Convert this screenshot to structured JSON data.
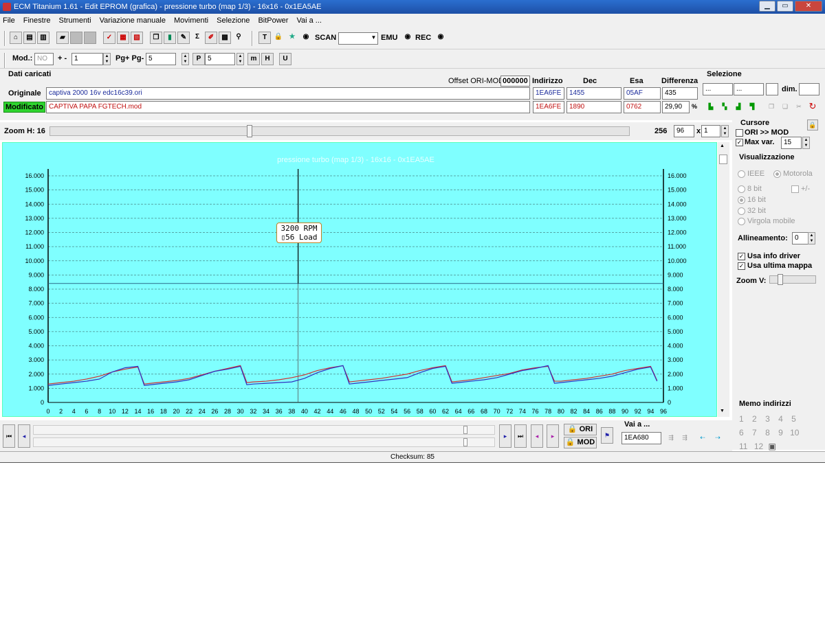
{
  "window": {
    "title": "ECM Titanium 1.61 - Edit EPROM (grafica) - pressione turbo (map 1/3) - 16x16 - 0x1EA5AE"
  },
  "menu": [
    "File",
    "Finestre",
    "Strumenti",
    "Variazione manuale",
    "Movimenti",
    "Selezione",
    "BitPower",
    "Vai a ..."
  ],
  "toolbar": {
    "scan": "SCAN",
    "emu": "EMU",
    "rec": "REC",
    "mod_label": "Mod.:",
    "mod_value": "NO",
    "plusminus": "+ -",
    "step_value": "1",
    "pg_label": "Pg+ Pg-",
    "pg_value": "5",
    "p_value": "5"
  },
  "loaded": {
    "section": "Dati caricati",
    "offset_label": "Offset ORI-MOD",
    "offset_value": "000000",
    "col_indirizzo": "Indirizzo",
    "col_dec": "Dec",
    "col_esa": "Esa",
    "col_diff": "Differenza",
    "orig_label": "Originale",
    "orig_file": "captiva 2000 16v edc16c39.ori",
    "orig_addr": "1EA6FE",
    "orig_dec": "1455",
    "orig_esa": "05AF",
    "orig_diff": "435",
    "mod_label": "Modificato",
    "mod_file": "CAPTIVA PAPA FGTECH.mod",
    "mod_addr": "1EA6FE",
    "mod_dec": "1890",
    "mod_esa": "0762",
    "mod_diff_pct": "29,90",
    "pct": "%"
  },
  "selezione": {
    "title": "Selezione",
    "a": "...",
    "b": "...",
    "dim": "dim."
  },
  "zoom": {
    "label": "Zoom H: 16",
    "value1": "256",
    "value2": "96",
    "times": "x",
    "value3": "1"
  },
  "cursore": {
    "title": "Cursore",
    "ori_mod": "ORI >> MOD",
    "maxvar": "Max var.",
    "maxvar_value": "15"
  },
  "vis": {
    "title": "Visualizzazione",
    "ieee": "IEEE",
    "motorola": "Motorola",
    "b8": "8 bit",
    "pm": "+/-",
    "b16": "16 bit",
    "b32": "32 bit",
    "virgola": "Virgola mobile",
    "allineamento": "Allineamento:",
    "allin_value": "0",
    "usa_info": "Usa info driver",
    "usa_ultima": "Usa ultima mappa",
    "zoomv": "Zoom V:"
  },
  "memo": {
    "title": "Memo indirizzi",
    "nums": [
      "1",
      "2",
      "3",
      "4",
      "5",
      "6",
      "7",
      "8",
      "9",
      "10",
      "11",
      "12"
    ]
  },
  "bottom": {
    "ori": "ORI",
    "mod": "MOD",
    "vai": "Vai a ...",
    "vai_value": "1EA680"
  },
  "status": {
    "checksum": "Checksum: 85"
  },
  "tooltip": {
    "line1": "3200 RPM",
    "line2": "▯56 Load"
  },
  "chart_data": {
    "type": "line",
    "title": "pressione turbo (map 1/3) - 16x16 - 0x1EA5AE",
    "xlim": [
      0,
      96
    ],
    "ylim": [
      0,
      16000
    ],
    "xticks": [
      "0",
      "2",
      "4",
      "6",
      "8",
      "10",
      "12",
      "14",
      "16",
      "18",
      "20",
      "22",
      "24",
      "26",
      "28",
      "30",
      "32",
      "34",
      "36",
      "38",
      "40",
      "42",
      "44",
      "46",
      "48",
      "50",
      "52",
      "54",
      "56",
      "58",
      "60",
      "62",
      "64",
      "66",
      "68",
      "70",
      "72",
      "74",
      "76",
      "78",
      "80",
      "82",
      "84",
      "86",
      "88",
      "90",
      "92",
      "94",
      "96"
    ],
    "yticks": [
      "0",
      "1.000",
      "2.000",
      "3.000",
      "4.000",
      "5.000",
      "6.000",
      "7.000",
      "8.000",
      "9.000",
      "10.000",
      "11.000",
      "12.000",
      "13.000",
      "14.000",
      "15.000",
      "16.000"
    ],
    "cursor_x": 39,
    "hline_y": 8400,
    "series": [
      {
        "color": "#d03030",
        "x": [
          0,
          2,
          4,
          6,
          8,
          10,
          12,
          14,
          15,
          16,
          18,
          20,
          22,
          24,
          26,
          28,
          30,
          31,
          32,
          34,
          36,
          38,
          40,
          42,
          44,
          46,
          47,
          48,
          50,
          52,
          54,
          56,
          58,
          60,
          62,
          63,
          64,
          66,
          68,
          70,
          72,
          74,
          76,
          78,
          79,
          80,
          82,
          84,
          86,
          88,
          90,
          92,
          94,
          95
        ],
        "values": [
          1300,
          1400,
          1500,
          1650,
          1850,
          2150,
          2350,
          2500,
          1300,
          1350,
          1450,
          1550,
          1700,
          1950,
          2200,
          2400,
          2600,
          1400,
          1450,
          1500,
          1600,
          1750,
          1950,
          2250,
          2450,
          2600,
          1450,
          1500,
          1600,
          1700,
          1850,
          2000,
          2250,
          2450,
          2600,
          1450,
          1500,
          1600,
          1750,
          1900,
          2050,
          2300,
          2450,
          2550,
          1500,
          1500,
          1600,
          1700,
          1850,
          2000,
          2250,
          2400,
          2550,
          1550
        ]
      },
      {
        "color": "#3030c0",
        "x": [
          0,
          2,
          4,
          6,
          8,
          10,
          12,
          14,
          15,
          16,
          18,
          20,
          22,
          24,
          26,
          28,
          30,
          31,
          32,
          34,
          36,
          38,
          40,
          42,
          44,
          46,
          47,
          48,
          50,
          52,
          54,
          56,
          58,
          60,
          62,
          63,
          64,
          66,
          68,
          70,
          72,
          74,
          76,
          78,
          79,
          80,
          82,
          84,
          86,
          88,
          90,
          92,
          94,
          95
        ],
        "values": [
          1200,
          1300,
          1400,
          1500,
          1650,
          2150,
          2450,
          2550,
          1200,
          1250,
          1350,
          1450,
          1600,
          1900,
          2200,
          2350,
          2550,
          1250,
          1300,
          1350,
          1400,
          1450,
          1700,
          2100,
          2400,
          2600,
          1300,
          1350,
          1450,
          1550,
          1650,
          1750,
          2100,
          2400,
          2550,
          1350,
          1400,
          1500,
          1600,
          1750,
          2000,
          2250,
          2400,
          2600,
          1350,
          1400,
          1500,
          1600,
          1700,
          1850,
          2100,
          2350,
          2500,
          1500
        ]
      }
    ]
  }
}
